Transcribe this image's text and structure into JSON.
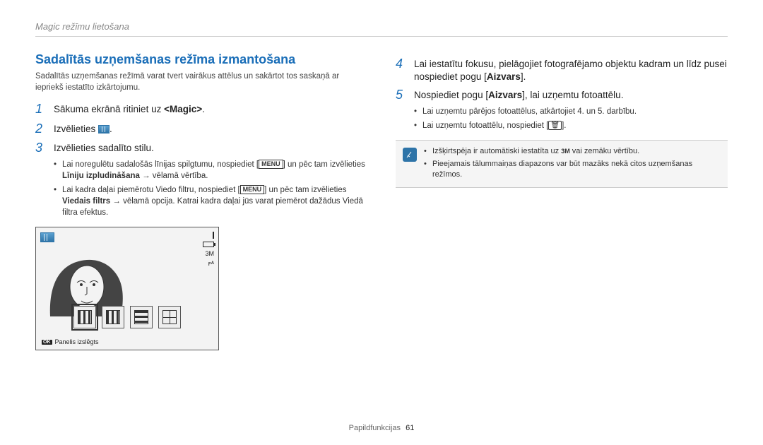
{
  "header": {
    "breadcrumb": "Magic režīmu lietošana"
  },
  "left": {
    "title": "Sadalītās uzņemšanas režīma izmantošana",
    "intro": "Sadalītās uzņemšanas režīmā varat tvert vairākus attēlus un sakārtot tos saskaņā ar iepriekš iestatīto izkārtojumu.",
    "step1": {
      "num": "1",
      "prefix": "Sākuma ekrānā ritiniet uz ",
      "magic": "<Magic>",
      "suffix": "."
    },
    "step2": {
      "num": "2",
      "text": "Izvēlieties "
    },
    "step3": {
      "num": "3",
      "text": "Izvēlieties sadalīto stilu."
    },
    "sub3": {
      "a_prefix": "Lai noregulētu sadalošās līnijas spilgtumu, nospiediet [",
      "a_menu": "MENU",
      "a_mid": "] un pēc tam izvēlieties ",
      "a_bold": "Līniju izpludināšana",
      "a_arrow": " → ",
      "a_suffix": "vēlamā vērtība.",
      "b_prefix": "Lai kadra daļai piemērotu Viedo filtru, nospiediet [",
      "b_menu": "MENU",
      "b_mid": "] un pēc tam izvēlieties ",
      "b_bold": "Viedais filtrs",
      "b_arrow": " → ",
      "b_suffix": "vēlamā opcija. Katrai kadra daļai jūs varat piemērot dažādus Viedā filtra efektus."
    },
    "illus": {
      "right_labels": {
        "iso": "3M",
        "flash": "ꜰᴬ"
      },
      "caption_ok": "OK",
      "caption_text": "Panelis izslēgts"
    }
  },
  "right": {
    "step4": {
      "num": "4",
      "line1_prefix": "Lai iestatītu fokusu, pielāgojiet fotografējamo objektu kadram un līdz pusei nospiediet pogu [",
      "bold": "Aizvars",
      "line1_suffix": "]."
    },
    "step5": {
      "num": "5",
      "prefix": "Nospiediet pogu [",
      "bold": "Aizvars",
      "suffix": "], lai uzņemtu fotoattēlu."
    },
    "sub5": {
      "a": "Lai uzņemtu pārējos fotoattēlus, atkārtojiet 4. un 5. darbību.",
      "b_prefix": "Lai uzņemtu fotoattēlu, nospiediet [",
      "b_suffix": "]."
    },
    "note": {
      "a_prefix": "Izšķirtspēja ir automātiski iestatīta uz ",
      "a_iso": "3M",
      "a_suffix": " vai zemāku vērtību.",
      "b": "Pieejamais tālummaiņas diapazons var būt mazāks nekā citos uzņemšanas režīmos."
    }
  },
  "footer": {
    "section": "Papildfunkcijas",
    "page": "61"
  }
}
